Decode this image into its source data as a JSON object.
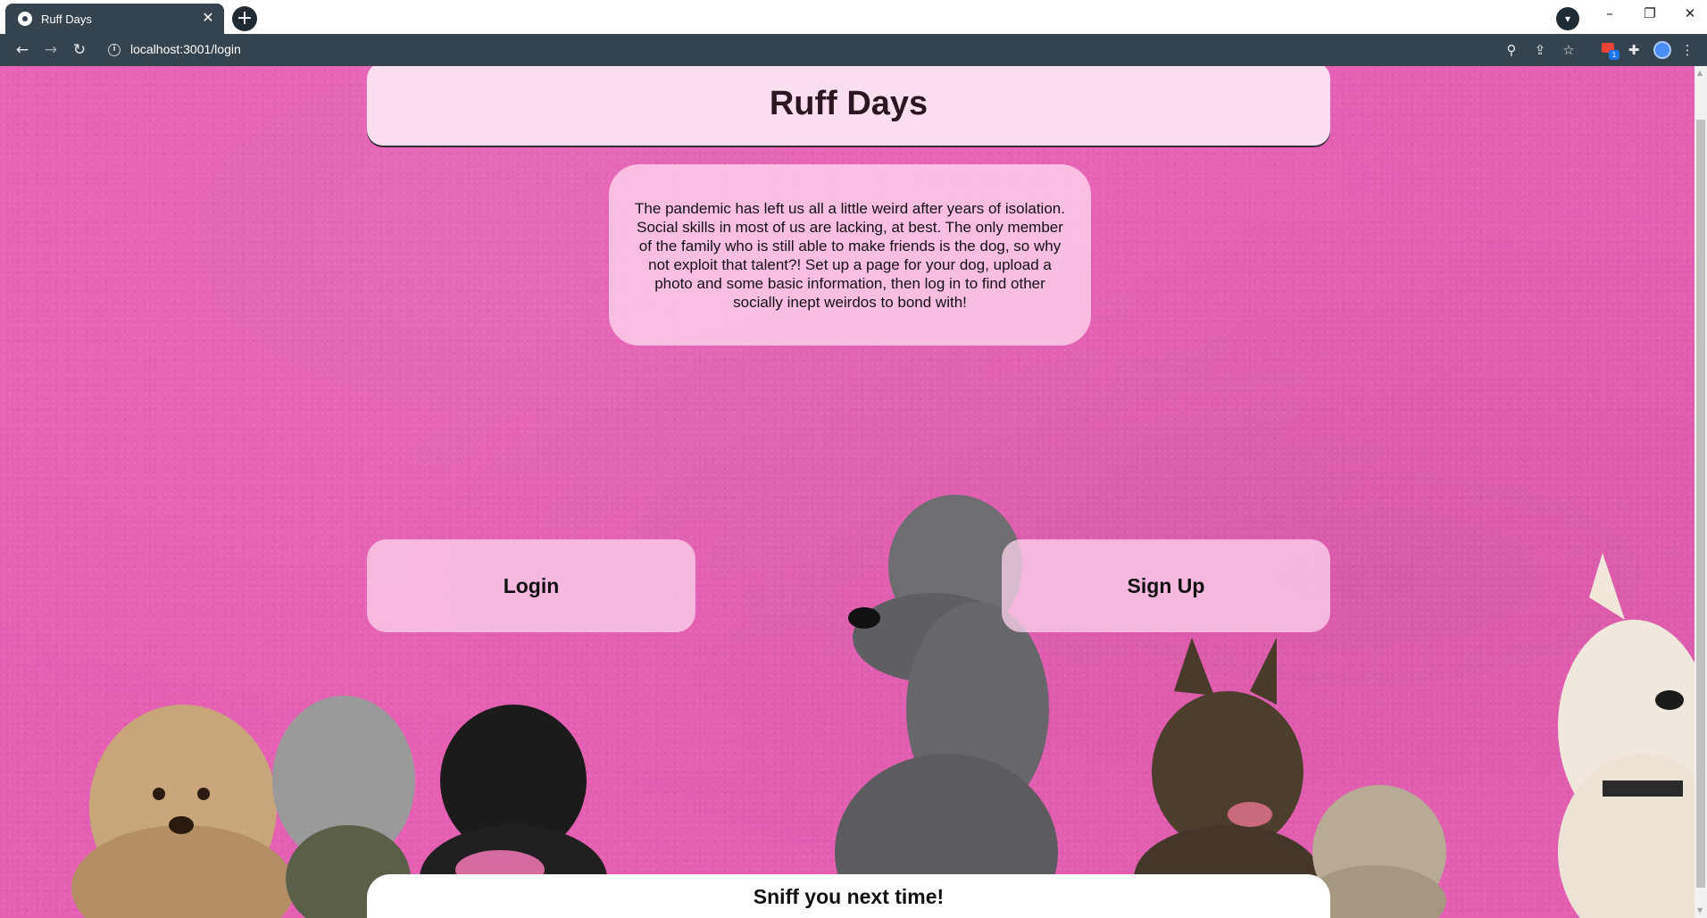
{
  "browser": {
    "tab_title": "Ruff Days",
    "url": "localhost:3001/login",
    "extension_badge": "1"
  },
  "page": {
    "site_title": "Ruff Days",
    "intro": "The pandemic has left us all a little weird after years of isolation. Social skills in most of us are lacking, at best. The only member of the family who is still able to make friends is the dog, so why not exploit that talent?! Set up a page for your dog, upload a photo and some basic information, then log in to find other socially inept weirdos to bond with!",
    "login_label": "Login",
    "signup_label": "Sign Up",
    "footer_text": "Sniff you next time!"
  },
  "colors": {
    "background_pink": "#e55fb3",
    "card_pink": "#fbdff0",
    "chrome_dark": "#35434f"
  }
}
